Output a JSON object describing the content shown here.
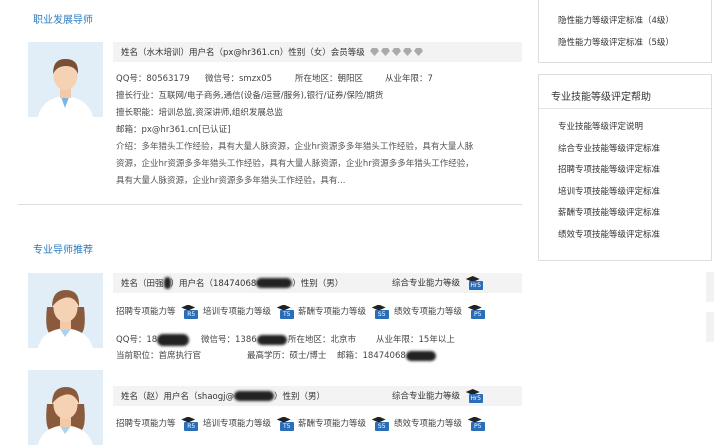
{
  "left": {
    "career_title": "职业发展导师",
    "mentor": {
      "name_line": "姓名（水木培训）用户名（px@hr361.cn）性别（女）会员等级",
      "qq": "QQ号：80563179",
      "wechat": "微信号：smzx05",
      "region": "所在地区：朝阳区",
      "years": "从业年限：7",
      "industry": "擅长行业：互联网/电子商务,通信(设备/运营/服务),银行/证券/保险/期货",
      "position": "擅长职能：培训总监,资深讲师,组织发展总监",
      "email_prefix": "邮箱：px@hr361.cn",
      "email_verified": "[已认证]",
      "intro": "介绍：多年猎头工作经验，具有大量人脉资源，企业hr资源多多年猎头工作经验，具有大量人脉资源，企业hr资源多多年猎头工作经验，具有大量人脉资源，企业hr资源多多年猎头工作经验，具有大量人脉资源，企业hr资源多多年猎头工作经验，具有..."
    },
    "recommend_title": "专业导师推荐",
    "mentors": [
      {
        "name_prefix": "姓名（田强",
        "name_mid": "）用户名（18474068",
        "name_tail": "）性别（男）",
        "overall": "综合专业能力等级",
        "overall_level": "Hr5",
        "skills": [
          {
            "label": "招聘专项能力等",
            "level": "R5"
          },
          {
            "label": "培训专项能力等级",
            "level": "T5"
          },
          {
            "label": "薪酬专项能力等级",
            "level": "S5"
          },
          {
            "label": "绩效专项能力等级",
            "level": "P5"
          }
        ],
        "qq": "QQ号：18",
        "wechat": "微信号：1386",
        "region": "所在地区：北京市",
        "years": "从业年限：15年以上",
        "current": "当前职位：首席执行官",
        "degree": "最高学历：硕士/博士",
        "email": "邮箱：18474068"
      },
      {
        "name_prefix": "姓名（赵）用户名（shaogj@",
        "name_tail": "）性别（男）",
        "overall": "综合专业能力等级",
        "overall_level": "Hr5",
        "skills": [
          {
            "label": "招聘专项能力等",
            "level": "R5"
          },
          {
            "label": "培训专项能力等级",
            "level": "T5"
          },
          {
            "label": "薪酬专项能力等级",
            "level": "S5"
          },
          {
            "label": "绩效专项能力等级",
            "level": "P5"
          }
        ]
      }
    ]
  },
  "sidebar": {
    "top_links": [
      "隐性能力等级评定标准（4级）",
      "隐性能力等级评定标准（5级）"
    ],
    "help_title": "专业技能等级评定帮助",
    "help_links": [
      "专业技能等级评定说明",
      "综合专业技能等级评定标准",
      "招聘专项技能等级评定标准",
      "培训专项技能等级评定标准",
      "薪酬专项技能等级评定标准",
      "绩效专项技能等级评定标准"
    ]
  }
}
